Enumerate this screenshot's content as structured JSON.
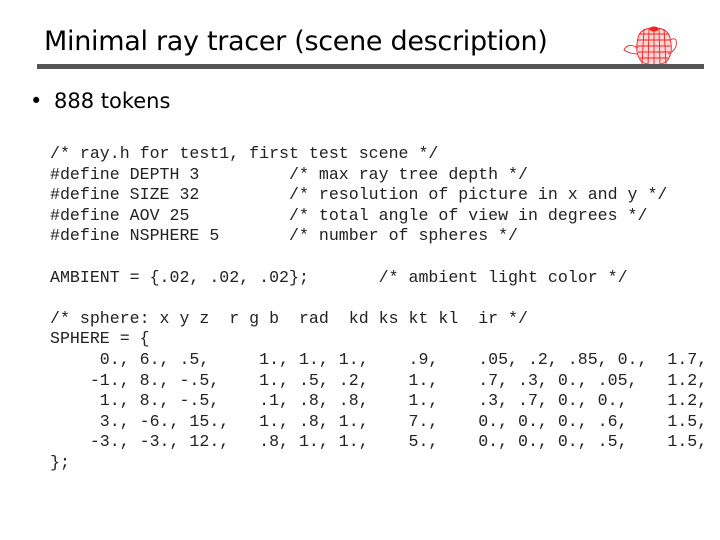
{
  "slide": {
    "title": "Minimal ray tracer (scene description)",
    "logo_icon": "teapot-icon",
    "bullets": [
      {
        "marker": "•",
        "text": "888 tokens"
      }
    ]
  },
  "code": {
    "lines": [
      "/* ray.h for test1, first test scene */",
      "#define DEPTH 3         /* max ray tree depth */",
      "#define SIZE 32         /* resolution of picture in x and y */",
      "#define AOV 25          /* total angle of view in degrees */",
      "#define NSPHERE 5       /* number of spheres */",
      "",
      "AMBIENT = {.02, .02, .02};       /* ambient light color */",
      "",
      "/* sphere: x y z  r g b  rad  kd ks kt kl  ir */",
      "SPHERE = {",
      "     0., 6., .5,     1., 1., 1.,    .9,    .05, .2, .85, 0.,  1.7,",
      "    -1., 8., -.5,    1., .5, .2,    1.,    .7, .3, 0., .05,   1.2,",
      "     1., 8., -.5,    .1, .8, .8,    1.,    .3, .7, 0., 0.,    1.2,",
      "     3., -6., 15.,   1., .8, 1.,    7.,    0., 0., 0., .6,    1.5,",
      "    -3., -3., 12.,   .8, 1., 1.,    5.,    0., 0., 0., .5,    1.5,",
      "};"
    ]
  }
}
